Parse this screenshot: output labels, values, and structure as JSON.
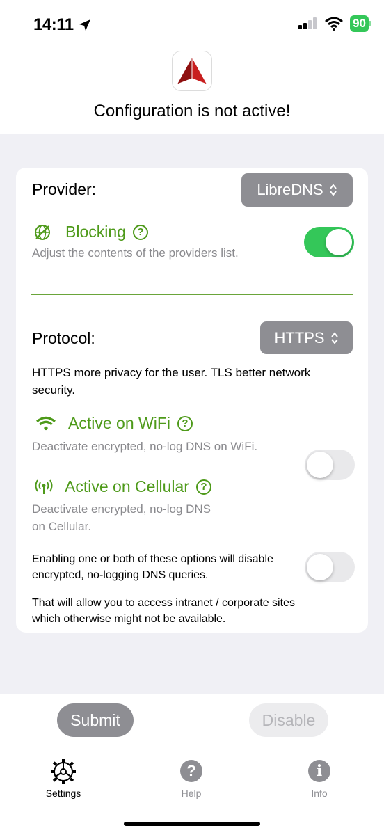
{
  "status_bar": {
    "time": "14:11",
    "battery": "90"
  },
  "header": {
    "config_title": "Configuration is not active!"
  },
  "provider": {
    "label": "Provider:",
    "value": "LibreDNS"
  },
  "blocking": {
    "title": "Blocking",
    "subtitle": "Adjust the contents of the providers list.",
    "enabled": true
  },
  "protocol": {
    "label": "Protocol:",
    "value": "HTTPS",
    "description": "HTTPS more privacy for the user.  TLS better network security."
  },
  "wifi": {
    "title": "Active on WiFi",
    "subtitle": "Deactivate  encrypted, no-log DNS on WiFi.",
    "enabled": false
  },
  "cellular": {
    "title": "Active on Cellular",
    "subtitle_line1": "Deactivate encrypted, no-log DNS",
    "subtitle_line2": "on Cellular.",
    "enabled": false
  },
  "notes": {
    "note1_line1": "Enabling one or both of these options will disable",
    "note1_line2": "encrypted, no-logging DNS queries.",
    "note2_line1": "That will allow you to access intranet / corporate sites",
    "note2_line2": "which otherwise might not be available."
  },
  "actions": {
    "submit_label": "Submit",
    "disable_label": "Disable"
  },
  "tabs": [
    {
      "label": "Settings",
      "icon": "gear-icon"
    },
    {
      "label": "Help",
      "icon": "question-icon"
    },
    {
      "label": "Info",
      "icon": "info-icon"
    }
  ],
  "colors": {
    "accent_green": "#4e9a1a",
    "toggle_on": "#34c759",
    "picker_gray": "#8e8e93"
  }
}
